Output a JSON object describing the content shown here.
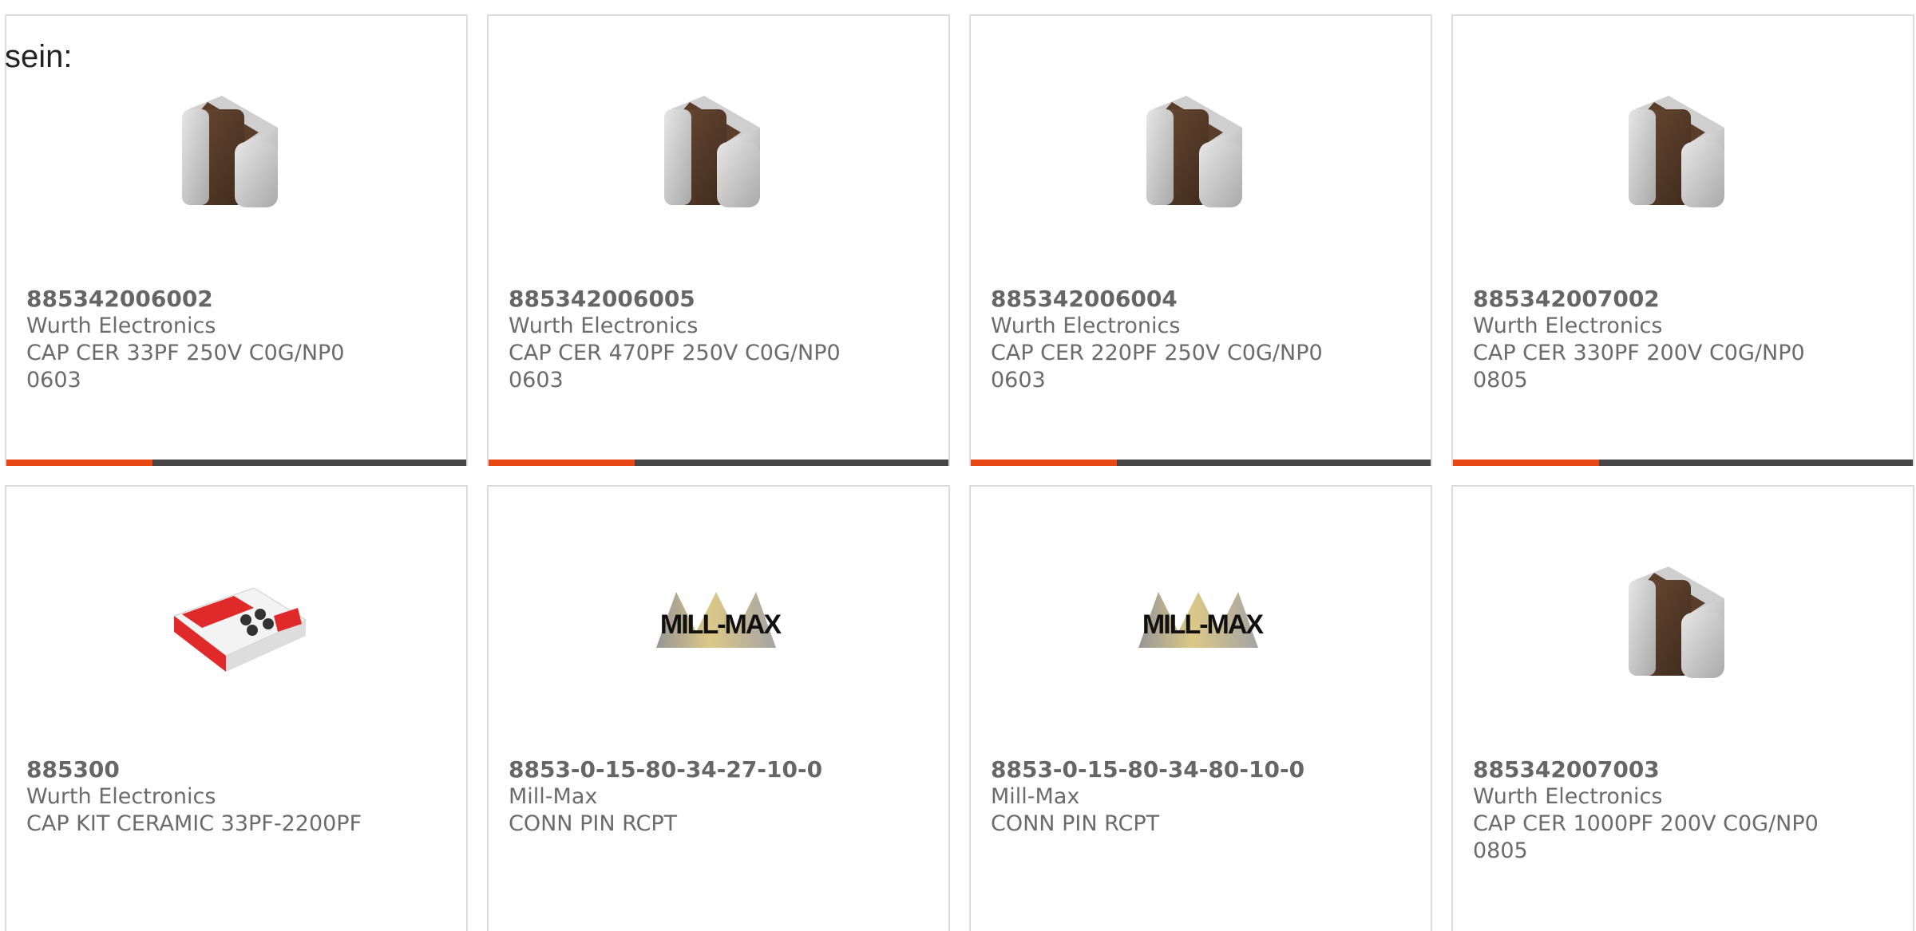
{
  "lead_text": "sein:",
  "products": [
    {
      "part_number": "885342006002",
      "manufacturer": "Wurth Electronics",
      "description": "CAP CER 33PF 250V C0G/NP0",
      "package": "0603",
      "image": "capacitor-chip-icon",
      "row": 1
    },
    {
      "part_number": "885342006005",
      "manufacturer": "Wurth Electronics",
      "description": "CAP CER 470PF 250V C0G/NP0",
      "package": "0603",
      "image": "capacitor-chip-icon",
      "row": 1
    },
    {
      "part_number": "885342006004",
      "manufacturer": "Wurth Electronics",
      "description": "CAP CER 220PF 250V C0G/NP0",
      "package": "0603",
      "image": "capacitor-chip-icon",
      "row": 1
    },
    {
      "part_number": "885342007002",
      "manufacturer": "Wurth Electronics",
      "description": "CAP CER 330PF 200V C0G/NP0",
      "package": "0805",
      "image": "capacitor-chip-icon",
      "row": 1
    },
    {
      "part_number": "885300",
      "manufacturer": "Wurth Electronics",
      "description": "CAP KIT CERAMIC 33PF-2200PF",
      "package": "",
      "image": "kit-box-icon",
      "row": 2
    },
    {
      "part_number": "8853-0-15-80-34-27-10-0",
      "manufacturer": "Mill-Max",
      "description": "CONN PIN RCPT",
      "package": "",
      "image": "mill-max-logo",
      "row": 2
    },
    {
      "part_number": "8853-0-15-80-34-80-10-0",
      "manufacturer": "Mill-Max",
      "description": "CONN PIN RCPT",
      "package": "",
      "image": "mill-max-logo",
      "row": 2
    },
    {
      "part_number": "885342007003",
      "manufacturer": "Wurth Electronics",
      "description": "CAP CER 1000PF 200V C0G/NP0",
      "package": "0805",
      "image": "capacitor-chip-icon",
      "row": 2
    }
  ],
  "logo_text": "MILL-MAX",
  "colors": {
    "accent": "#e84813",
    "bar": "#454545",
    "border": "#dcdcdc",
    "text": "#6b6b6b"
  }
}
